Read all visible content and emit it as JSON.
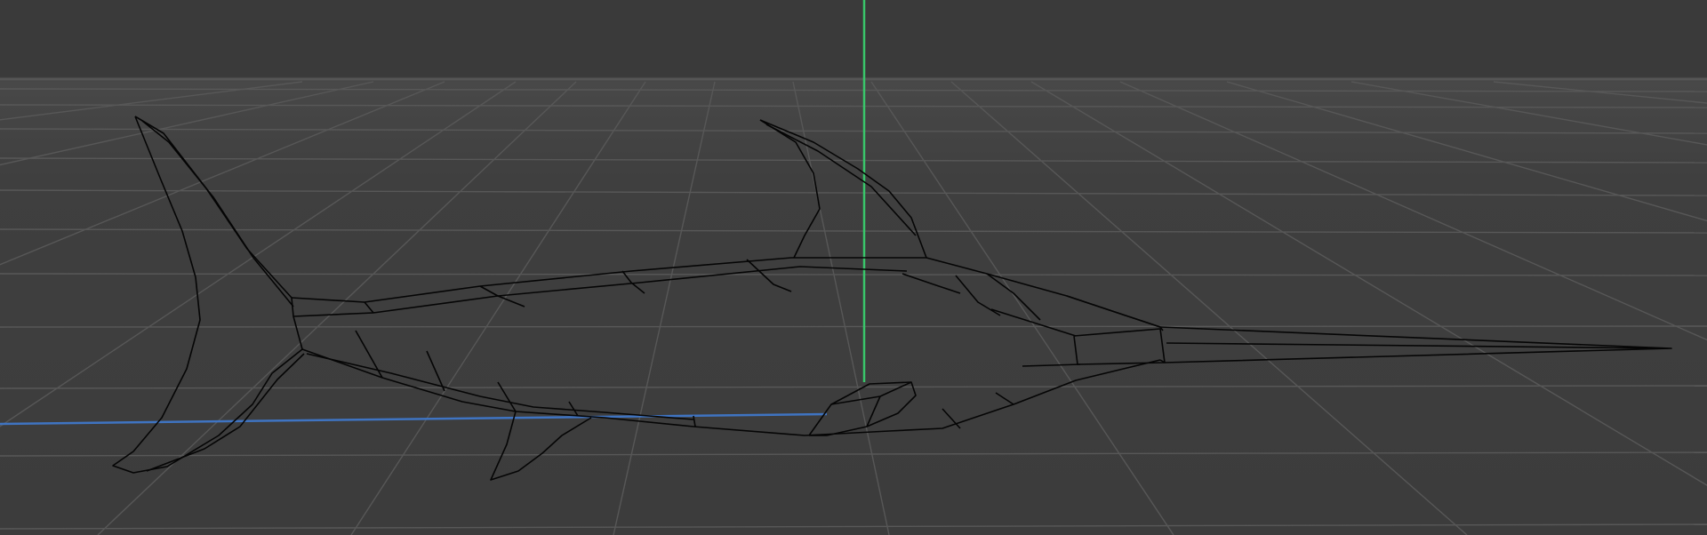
{
  "viewport": {
    "view": "perspective",
    "shading": "wireframe",
    "background": "#3d3d3d",
    "grid_color": "#5a5a5a",
    "floor_grid": true
  },
  "axes": {
    "x_axis_color": "#3f74c2",
    "y_axis_color": "#39c66a"
  },
  "object": {
    "kind": "marlin-mesh",
    "wire_color": "#050505"
  }
}
